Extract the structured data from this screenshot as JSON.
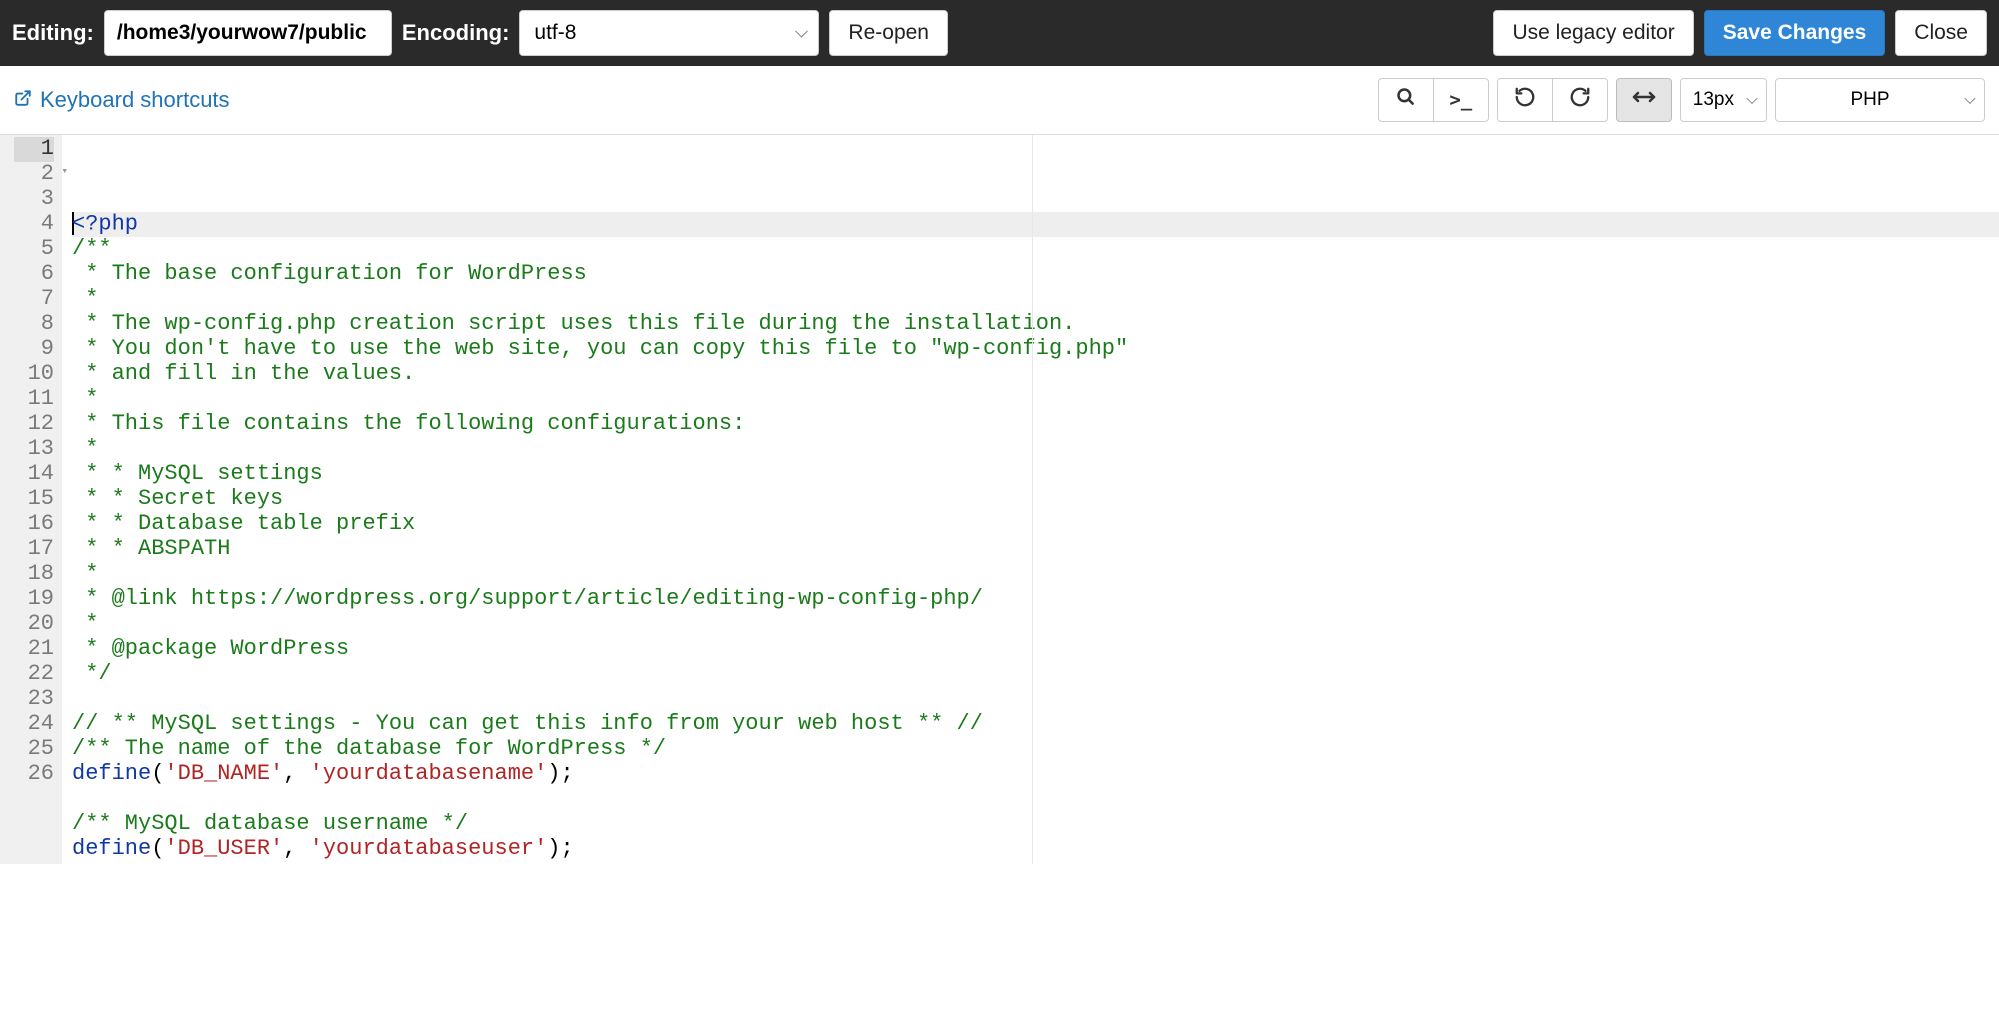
{
  "topbar": {
    "editing_label": "Editing:",
    "filepath_value": "/home3/yourwow7/public",
    "encoding_label": "Encoding:",
    "encoding_value": "utf-8",
    "reopen_label": "Re-open",
    "legacy_label": "Use legacy editor",
    "save_label": "Save Changes",
    "close_label": "Close"
  },
  "toolbar": {
    "keyboard_shortcuts_label": "Keyboard shortcuts",
    "fontsize_value": "13px",
    "lang_value": "PHP"
  },
  "code": {
    "lines": [
      {
        "n": 1,
        "hl": true,
        "segments": [
          {
            "t": "keyword",
            "v": "<?php"
          }
        ]
      },
      {
        "n": 2,
        "fold": true,
        "segments": [
          {
            "t": "comment",
            "v": "/**"
          }
        ]
      },
      {
        "n": 3,
        "segments": [
          {
            "t": "comment",
            "v": " * The base configuration for WordPress"
          }
        ]
      },
      {
        "n": 4,
        "segments": [
          {
            "t": "comment",
            "v": " *"
          }
        ]
      },
      {
        "n": 5,
        "segments": [
          {
            "t": "comment",
            "v": " * The wp-config.php creation script uses this file during the installation."
          }
        ]
      },
      {
        "n": 6,
        "segments": [
          {
            "t": "comment",
            "v": " * You don't have to use the web site, you can copy this file to \"wp-config.php\""
          }
        ]
      },
      {
        "n": 7,
        "segments": [
          {
            "t": "comment",
            "v": " * and fill in the values."
          }
        ]
      },
      {
        "n": 8,
        "segments": [
          {
            "t": "comment",
            "v": " *"
          }
        ]
      },
      {
        "n": 9,
        "segments": [
          {
            "t": "comment",
            "v": " * This file contains the following configurations:"
          }
        ]
      },
      {
        "n": 10,
        "segments": [
          {
            "t": "comment",
            "v": " *"
          }
        ]
      },
      {
        "n": 11,
        "segments": [
          {
            "t": "comment",
            "v": " * * MySQL settings"
          }
        ]
      },
      {
        "n": 12,
        "segments": [
          {
            "t": "comment",
            "v": " * * Secret keys"
          }
        ]
      },
      {
        "n": 13,
        "segments": [
          {
            "t": "comment",
            "v": " * * Database table prefix"
          }
        ]
      },
      {
        "n": 14,
        "segments": [
          {
            "t": "comment",
            "v": " * * ABSPATH"
          }
        ]
      },
      {
        "n": 15,
        "segments": [
          {
            "t": "comment",
            "v": " *"
          }
        ]
      },
      {
        "n": 16,
        "segments": [
          {
            "t": "comment",
            "v": " * @link https://wordpress.org/support/article/editing-wp-config-php/"
          }
        ]
      },
      {
        "n": 17,
        "segments": [
          {
            "t": "comment",
            "v": " *"
          }
        ]
      },
      {
        "n": 18,
        "segments": [
          {
            "t": "comment",
            "v": " * @package WordPress"
          }
        ]
      },
      {
        "n": 19,
        "segments": [
          {
            "t": "comment",
            "v": " */"
          }
        ]
      },
      {
        "n": 20,
        "segments": []
      },
      {
        "n": 21,
        "segments": [
          {
            "t": "comment",
            "v": "// ** MySQL settings - You can get this info from your web host ** //"
          }
        ]
      },
      {
        "n": 22,
        "segments": [
          {
            "t": "comment",
            "v": "/** The name of the database for WordPress */"
          }
        ]
      },
      {
        "n": 23,
        "segments": [
          {
            "t": "func",
            "v": "define"
          },
          {
            "t": "plain",
            "v": "("
          },
          {
            "t": "string",
            "v": "'DB_NAME'"
          },
          {
            "t": "plain",
            "v": ", "
          },
          {
            "t": "string",
            "v": "'yourdatabasename'"
          },
          {
            "t": "plain",
            "v": ");"
          }
        ]
      },
      {
        "n": 24,
        "segments": []
      },
      {
        "n": 25,
        "segments": [
          {
            "t": "comment",
            "v": "/** MySQL database username */"
          }
        ]
      },
      {
        "n": 26,
        "segments": [
          {
            "t": "func",
            "v": "define"
          },
          {
            "t": "plain",
            "v": "("
          },
          {
            "t": "string",
            "v": "'DB_USER'"
          },
          {
            "t": "plain",
            "v": ", "
          },
          {
            "t": "string",
            "v": "'yourdatabaseuser'"
          },
          {
            "t": "plain",
            "v": ");"
          }
        ]
      }
    ]
  }
}
